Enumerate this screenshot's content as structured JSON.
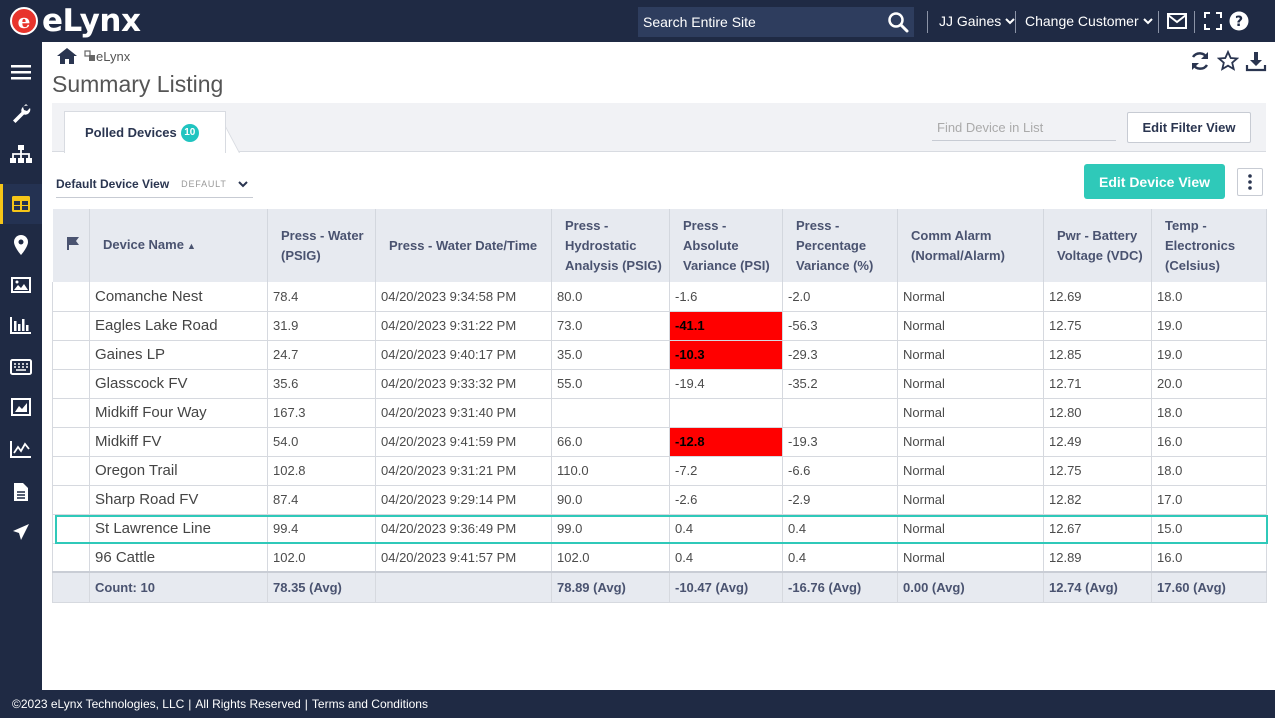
{
  "brand": {
    "logo_letter": "e",
    "logo_text": "eLynx"
  },
  "topbar": {
    "search_placeholder": "Search Entire Site",
    "user": "JJ Gaines",
    "change_customer": "Change Customer"
  },
  "breadcrumb": {
    "item": "eLynx"
  },
  "page": {
    "title": "Summary Listing"
  },
  "tab": {
    "label": "Polled Devices",
    "count": "10"
  },
  "filter": {
    "find_placeholder": "Find Device in List",
    "edit_filter_label": "Edit Filter View"
  },
  "view": {
    "selected": "Default Device View",
    "default_tag": "DEFAULT",
    "edit_device_label": "Edit Device View"
  },
  "table": {
    "columns": [
      "Device Name",
      "Press - Water (PSIG)",
      "Press - Water Date/Time",
      "Press - Hydrostatic Analysis (PSIG)",
      "Press - Absolute Variance (PSI)",
      "Press - Percentage Variance (%)",
      "Comm Alarm (Normal/Alarm)",
      "Pwr - Battery Voltage (VDC)",
      "Temp - Electronics (Celsius)"
    ],
    "rows": [
      [
        "Comanche Nest",
        "78.4",
        "04/20/2023 9:34:58 PM",
        "80.0",
        "-1.6",
        "-2.0",
        "Normal",
        "12.69",
        "18.0"
      ],
      [
        "Eagles Lake Road",
        "31.9",
        "04/20/2023 9:31:22 PM",
        "73.0",
        "-41.1",
        "-56.3",
        "Normal",
        "12.75",
        "19.0"
      ],
      [
        "Gaines LP",
        "24.7",
        "04/20/2023 9:40:17 PM",
        "35.0",
        "-10.3",
        "-29.3",
        "Normal",
        "12.85",
        "19.0"
      ],
      [
        "Glasscock FV",
        "35.6",
        "04/20/2023 9:33:32 PM",
        "55.0",
        "-19.4",
        "-35.2",
        "Normal",
        "12.71",
        "20.0"
      ],
      [
        "Midkiff Four Way",
        "167.3",
        "04/20/2023 9:31:40 PM",
        "",
        "",
        "",
        "Normal",
        "12.80",
        "18.0"
      ],
      [
        "Midkiff FV",
        "54.0",
        "04/20/2023 9:41:59 PM",
        "66.0",
        "-12.8",
        "-19.3",
        "Normal",
        "12.49",
        "16.0"
      ],
      [
        "Oregon Trail",
        "102.8",
        "04/20/2023 9:31:21 PM",
        "110.0",
        "-7.2",
        "-6.6",
        "Normal",
        "12.75",
        "18.0"
      ],
      [
        "Sharp Road FV",
        "87.4",
        "04/20/2023 9:29:14 PM",
        "90.0",
        "-2.6",
        "-2.9",
        "Normal",
        "12.82",
        "17.0"
      ],
      [
        "St Lawrence Line",
        "99.4",
        "04/20/2023 9:36:49 PM",
        "99.0",
        "0.4",
        "0.4",
        "Normal",
        "12.67",
        "15.0"
      ],
      [
        "96 Cattle",
        "102.0",
        "04/20/2023 9:41:57 PM",
        "102.0",
        "0.4",
        "0.4",
        "Normal",
        "12.89",
        "16.0"
      ]
    ],
    "alarm_color": "#ff0000",
    "footer": [
      "Count: 10",
      "78.35 (Avg)",
      "",
      "78.89 (Avg)",
      "-10.47 (Avg)",
      "-16.76 (Avg)",
      "0.00 (Avg)",
      "12.74 (Avg)",
      "17.60 (Avg)"
    ]
  },
  "footer": {
    "copyright": "©2023 eLynx Technologies, LLC",
    "sep1": "|",
    "rights": "All Rights Reserved",
    "sep2": "|",
    "terms": "Terms and Conditions"
  },
  "colors": {
    "nav_bg": "#1f2a44",
    "accent": "#2fc9b9",
    "active_marker": "#f5c518"
  }
}
